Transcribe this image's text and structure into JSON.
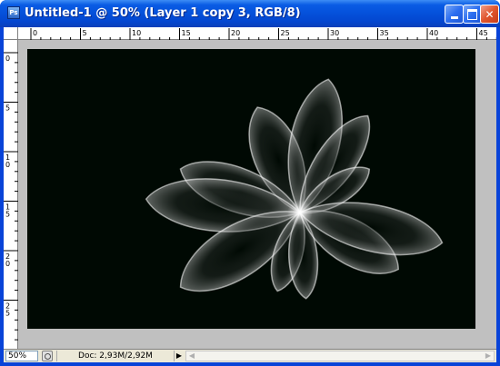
{
  "window": {
    "title": "Untitled-1 @ 50% (Layer 1 copy 3, RGB/8)",
    "app_icon": "photoshop-icon",
    "app_icon_text": "Ps",
    "controls": {
      "minimize": "minimize-icon",
      "maximize": "maximize-icon",
      "close": "close-icon",
      "close_glyph": "✕"
    },
    "titlebar_color": "#0552dc"
  },
  "rulers": {
    "horizontal_labels": [
      "0",
      "5",
      "10",
      "15",
      "20",
      "25",
      "30",
      "35",
      "40",
      "45"
    ],
    "vertical_labels": [
      "0",
      "5",
      "1\n0",
      "1\n5",
      "2\n0",
      "2\n5"
    ]
  },
  "canvas": {
    "background": "#000903",
    "content": "white translucent flower petals radiating from a bright center"
  },
  "statusbar": {
    "zoom": "50%",
    "doc_info": "Doc: 2,93M/2,92M",
    "menu_arrow": "▶",
    "scroll_left": "◀",
    "scroll_right": "▶"
  }
}
